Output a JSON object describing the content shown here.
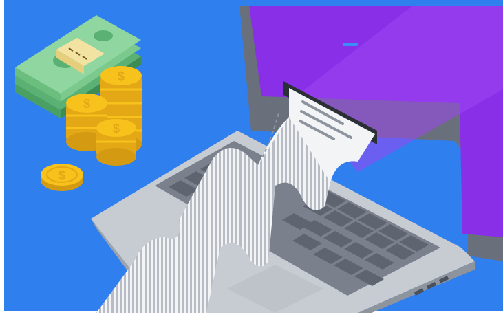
{
  "scene": {
    "background_color": "#2F7FEF",
    "screen_color": "#8A2FE8",
    "laptop_body_color": "#C7CCD3",
    "keyboard_key_color": "#5E6470",
    "receipt_color": "#F2F4F6",
    "coin_color": "#F7C21B",
    "cash_color": "#7CC98D",
    "elements": [
      {
        "name": "cash-stack",
        "icon": "banknote-stack-icon"
      },
      {
        "name": "coin-stacks",
        "icon": "dollar-coin-icon"
      },
      {
        "name": "loose-coin",
        "icon": "dollar-coin-icon"
      },
      {
        "name": "laptop",
        "icon": "laptop-icon"
      },
      {
        "name": "receipt",
        "icon": "receipt-icon"
      }
    ]
  }
}
